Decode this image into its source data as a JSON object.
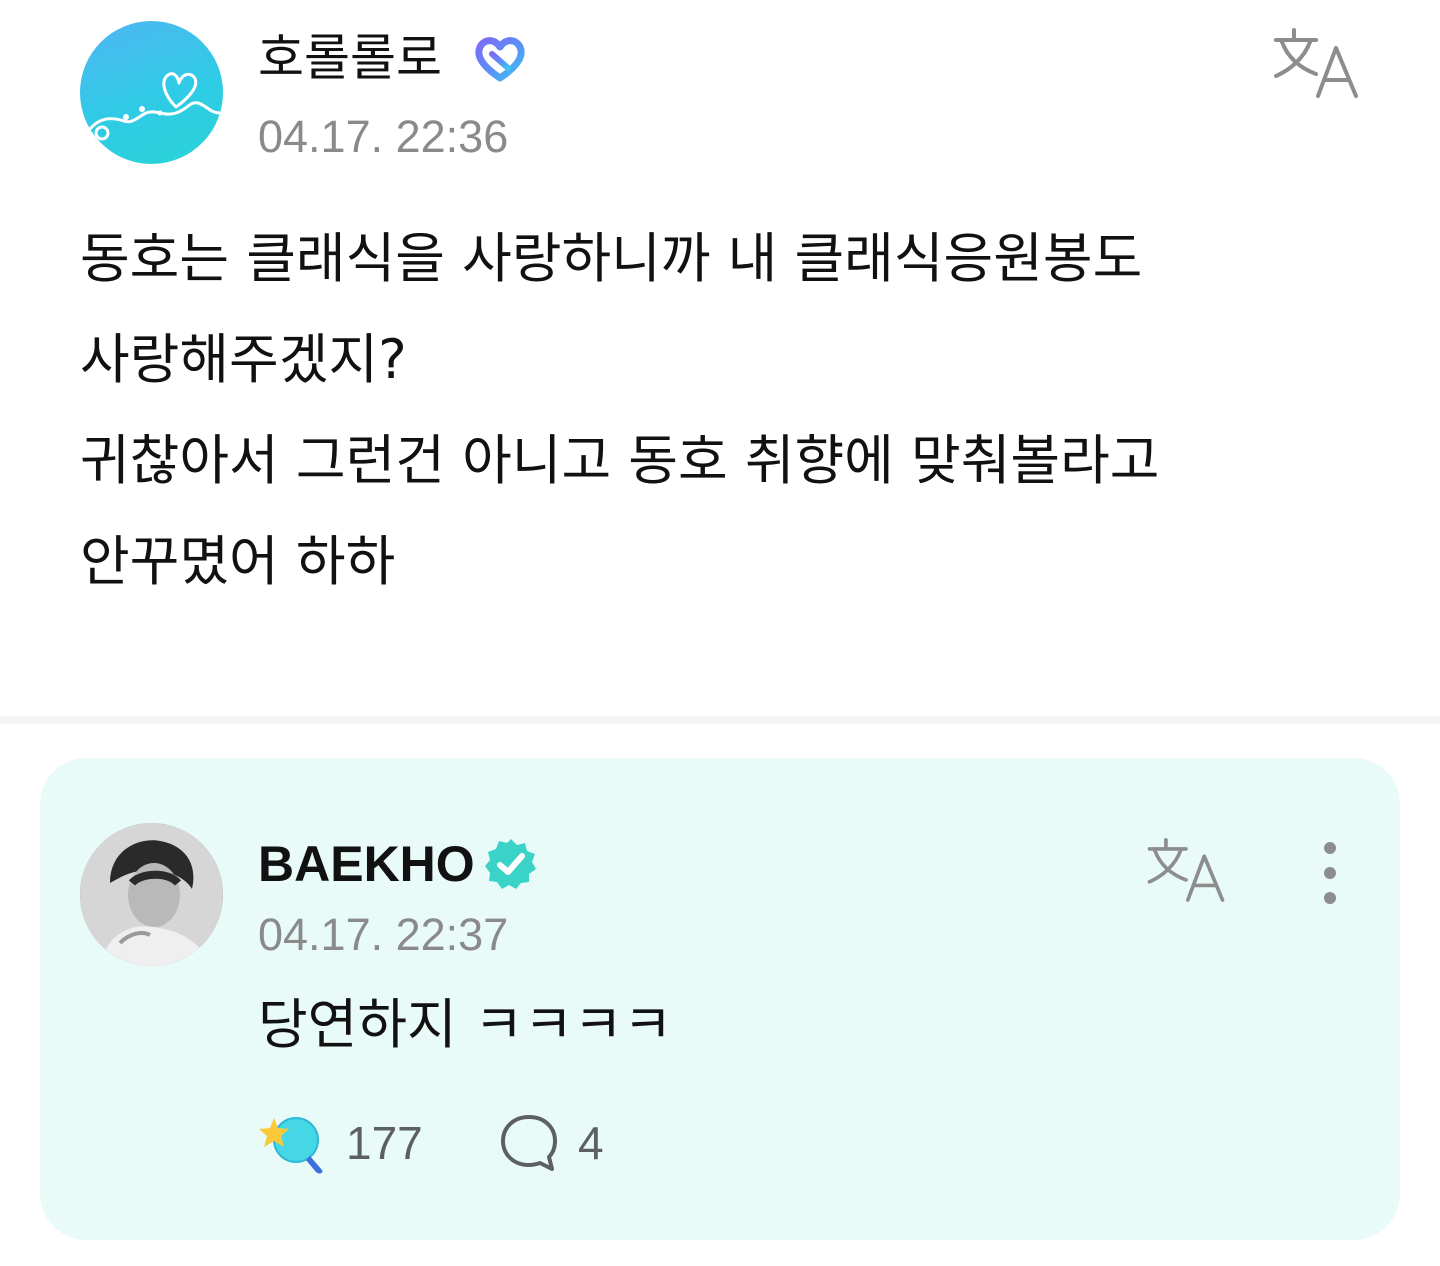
{
  "post": {
    "author": "호롤롤로",
    "timestamp": "04.17. 22:36",
    "body_lines": [
      "동호는 클래식을 사랑하니까 내 클래식응원봉도",
      "사랑해주겠지?",
      "귀찮아서 그런건 아니고 동호 취향에 맞춰볼라고",
      "안꾸몄어 하하"
    ],
    "avatar_icon": "heart-string-avatar",
    "badge_icon": "membership-heart-badge",
    "translate_icon": "translate-icon"
  },
  "reply": {
    "author": "BAEKHO",
    "timestamp": "04.17. 22:37",
    "text": "당연하지 ㅋㅋㅋㅋ",
    "badge_icon": "verified-badge-icon",
    "translate_icon": "translate-icon",
    "more_icon": "more-vertical-icon",
    "likes": "177",
    "comments": "4",
    "like_icon": "cheer-light-icon",
    "comment_icon": "comment-bubble-icon"
  },
  "colors": {
    "card_background": "#e9fbf8",
    "verified": "#3ad3c8",
    "timestamp": "#8a8a8a",
    "divider": "#f3f4f6"
  }
}
